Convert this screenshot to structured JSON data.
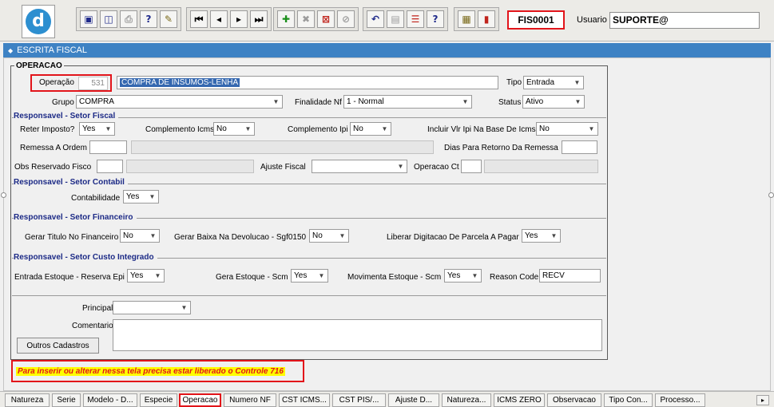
{
  "toolbar": {
    "logo_letter": "d",
    "form_code": "FIS0001",
    "user_label": "Usuario",
    "user_value": "SUPORTE@"
  },
  "icons": [
    "save-icon",
    "window-icon",
    "print-icon",
    "help-query-icon",
    "wand-icon",
    "first-record-icon",
    "prev-record-icon",
    "next-record-icon",
    "last-record-icon",
    "insert-record-icon",
    "delete-record-icon",
    "query-icon",
    "execute-query-icon",
    "undo-icon",
    "clipboard-icon",
    "list-icon",
    "help-icon",
    "menu-icon",
    "exit-icon"
  ],
  "window": {
    "title": "ESCRITA FISCAL"
  },
  "frame": {
    "legend": "OPERACAO"
  },
  "operacao": {
    "label": "Operação",
    "code": "531",
    "description": "COMPRA DE INSUMOS-LENHA",
    "tipo_label": "Tipo",
    "tipo_value": "Entrada",
    "grupo_label": "Grupo",
    "grupo_value": "COMPRA",
    "finalidade_label": "Finalidade Nf",
    "finalidade_value": "1 - Normal",
    "status_label": "Status",
    "status_value": "Ativo"
  },
  "fiscal": {
    "title": "Responsavel - Setor Fiscal",
    "reter_label": "Reter Imposto?",
    "reter_value": "Yes",
    "comp_icms_label": "Complemento Icms",
    "comp_icms_value": "No",
    "comp_ipi_label": "Complemento Ipi",
    "comp_ipi_value": "No",
    "incluir_label": "Incluir Vlr Ipi Na Base De Icms",
    "incluir_value": "No",
    "remessa_label": "Remessa A Ordem",
    "dias_label": "Dias Para Retorno Da Remessa",
    "obs_label": "Obs Reservado Fisco",
    "ajuste_label": "Ajuste Fiscal",
    "operacao_ct_label": "Operacao Ct"
  },
  "contabil": {
    "title": "Responsavel - Setor Contabil",
    "contabilidade_label": "Contabilidade",
    "contabilidade_value": "Yes"
  },
  "financeiro": {
    "title": "Responsavel - Setor Financeiro",
    "gerar_titulo_label": "Gerar Titulo No Financeiro",
    "gerar_titulo_value": "No",
    "gerar_baixa_label": "Gerar Baixa Na Devolucao - Sgf0150",
    "gerar_baixa_value": "No",
    "liberar_label": "Liberar Digitacao De Parcela A Pagar",
    "liberar_value": "Yes"
  },
  "custo": {
    "title": "Responsavel - Setor Custo Integrado",
    "entrada_label": "Entrada Estoque - Reserva Epi",
    "entrada_value": "Yes",
    "gera_label": "Gera Estoque - Scm",
    "gera_value": "Yes",
    "movimenta_label": "Movimenta Estoque - Scm",
    "movimenta_value": "Yes",
    "reason_label": "Reason Code",
    "reason_value": "RECV"
  },
  "footer_form": {
    "principal_label": "Principal",
    "comentario_label": "Comentario",
    "outros_button": "Outros Cadastros"
  },
  "warning": "Para inserir ou alterar nessa tela precisa estar liberado o Controle 716",
  "tabs": [
    "Natureza",
    "Serie",
    "Modelo - D...",
    "Especie",
    "Operacao",
    "Numero NF",
    "CST ICMS...",
    "CST PIS/...",
    "Ajuste D...",
    "Natureza...",
    "ICMS ZERO",
    "Observacao",
    "Tipo Con...",
    "Processo..."
  ],
  "tab_scroll": "▸"
}
